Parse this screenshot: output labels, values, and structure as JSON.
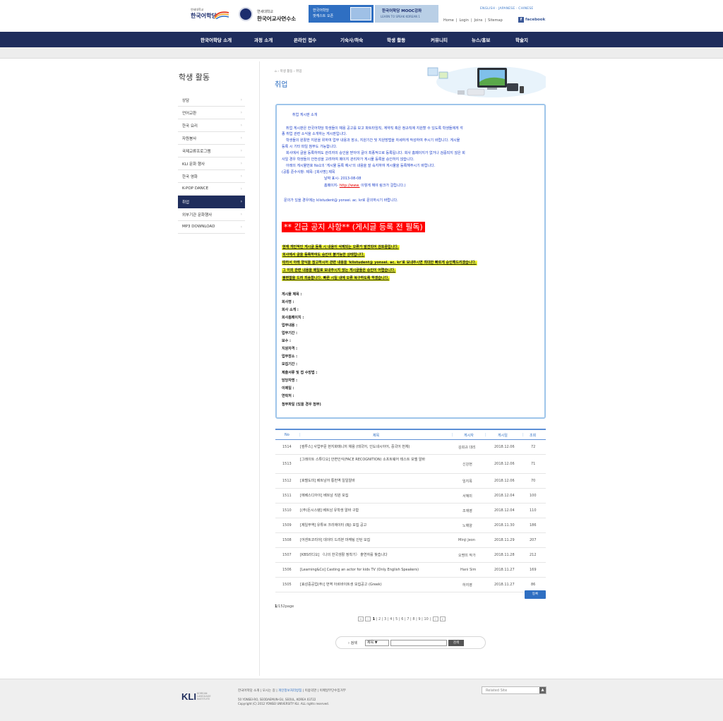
{
  "header": {
    "logo1_small": "연세대학교",
    "logo1_large": "한국어학당",
    "logo2_small": "연세대학교",
    "logo2_large": "한국어교사연수소",
    "banner1_line1": "한국어학당",
    "banner1_line2": "팟캐스트 오픈",
    "banner2_line1": "한국어학당 MOOC강좌",
    "banner2_line2": "LEARN TO SPEAK KOREAN 1",
    "languages": "ENGLISH · JAPANESE · CHINESE",
    "utils": [
      "Home",
      "|",
      "Login",
      "|",
      "Joins",
      "|",
      "Sitemap"
    ],
    "facebook": "facebook"
  },
  "nav": {
    "items": [
      "한국어학당 소개",
      "과정 소개",
      "온라인 접수",
      "기숙사/하숙",
      "학생 활동",
      "커뮤니티",
      "뉴스/홍보",
      "학술지"
    ]
  },
  "sidebar": {
    "title": "학생 활동",
    "items": [
      {
        "label": "상담"
      },
      {
        "label": "언어교환"
      },
      {
        "label": "한국 요리"
      },
      {
        "label": "자원봉사"
      },
      {
        "label": "국제교류프로그램"
      },
      {
        "label": "KLI 문화 행사"
      },
      {
        "label": "한국 영화"
      },
      {
        "label": "K-POP DANCE"
      },
      {
        "label": "취업"
      },
      {
        "label": "외부기관 문화행사"
      },
      {
        "label": "MP3 DOWNLOAD"
      }
    ],
    "arrow": "›"
  },
  "content": {
    "breadcrumb": "⌂  › 학생 활동  › 취업",
    "title": "취업",
    "notice": {
      "l1": "취업 게시판 소개",
      "l2": "취업 게시판은 한국어학당 학생들이 채용 공고를 보고 파트타임직, 계약직 혹은 정규직에 지원할 수 있도록  학생들에게 각",
      "l3": "종 취업 관련 소식을 소개하는 게시판입니다.",
      "l4": "학생들의 원활한  지원을 위하여  업무 내용과  장소, 지원기간 및  지원방법을 자세하게 작성하여 주시기 바랍니다. 게시물",
      "l5": "등록 시 기타 파일  첨부도 가능합니다.",
      "l6": "회사에서 글을 등록하여도 관리자의 승인을 받아야 글이 최종적으로 등록됩니다. 회사 홈페이지가 없거나 검증되지 않은 회",
      "l7": "사일 경우 학생들의 안전성을 고려하여 페이지 관리자가 게시물 등록을 승인하지 않습니다.",
      "l8": "아래의 게시물번호 No1의 '게시물 등록 예시'의 내용을 잘 숙지하여 게시물을 등록해주시기 바랍니다.",
      "l9": "(공통 준수사항: 제목- [회사명] 제목",
      "l10": "날짜 표시- 2013-08-08",
      "l11a": "홈페이지- ",
      "l11b": "http://www.",
      "l11c": " 이렇게 해야 링크가 걸립니다.)",
      "l12": "문의가 있을 경우에는 klistudent@ yonsei. ac. kr로 문의하시기 바랍니다.",
      "urgent": "** 긴급 공지 사항** (게시글 등록 전 필독)",
      "h1": "현재 개인적인 게시글 등록 시 내용이 삭제되는 오류가 발견되어 검토중입니다.",
      "h2": "회사에서 글을 등록하여도 승인이 불가능한 상태입니다.",
      "h3": "따라서 아래 양식을 참고하시어 관련 내용을 'klistudent@ yonsei. ac. kr'로 보내주시면 최대한 빠르게 승인해드리겠습니다.",
      "h4": "그 이외 관련 내용을 메일로 보내주시지 않는 게시글들은 승인이 어렵습니다.",
      "h5": "불편함을 드려 죄송합니다. 빠른 시일 내에 오류 복구하도록 하겠습니다.",
      "fields": [
        "게시물 제목 :",
        "회사명 :",
        "회사 소개 :",
        "회사홈페이지 :",
        "업무내용 :",
        "업무기간 :",
        "보수 :",
        "지원자격 :",
        "업무장소 :",
        "모집기간 :",
        "제출서류 및 접 수방법 :",
        "담당자명 :",
        "이메일 :",
        "연락처 :",
        "첨부파일 (있을 경우 첨부)"
      ]
    },
    "table": {
      "headers": {
        "no": "No",
        "title": "제목",
        "writer": "게시자",
        "date": "게시일",
        "views": "조회"
      },
      "rows": [
        {
          "no": "1514",
          "title": "[컴투스] 사업부문 현지화매니저 채용 (태국어, 인도네시아어, 중국어 번체)",
          "writer": "김희규 대리",
          "date": "2018.12.06",
          "views": "72"
        },
        {
          "no": "1513",
          "title": "[그레이트 스튜디오] 안면인식(FACE RECOGNITION) 소프트웨어 테스트 모델 알바",
          "writer": "신강현",
          "date": "2018.12.06",
          "views": "71"
        },
        {
          "no": "1512",
          "title": "[호텔도미] 베트남어 통번역 일일알바",
          "writer": "임지목",
          "date": "2018.12.06",
          "views": "70"
        },
        {
          "no": "1511",
          "title": "[에베스디아이] 베트남 직원 모집",
          "writer": "서혜미",
          "date": "2018.12.04",
          "views": "100"
        },
        {
          "no": "1510",
          "title": "[(주)돈시스템] 베트남 유학생 알바 구함",
          "writer": "조재영",
          "date": "2018.12.04",
          "views": "110"
        },
        {
          "no": "1509",
          "title": "[제일무역] 유튜브 크리에이터 (BJ) 모집 공고",
          "writer": "노해양",
          "date": "2018.11.30",
          "views": "186"
        },
        {
          "no": "1508",
          "title": "[어센트코리아] 데이터 드리븐 마케팅 인턴 모집",
          "writer": "Minji Jeon",
          "date": "2018.11.29",
          "views": "207"
        },
        {
          "no": "1507",
          "title": "[KBS라디오] 〈나의 한국생활 정착기〉 출연자를 찾습니다",
          "writer": "오명미 작가",
          "date": "2018.11.28",
          "views": "212"
        },
        {
          "no": "1506",
          "title": "[Learning&Co] Casting an actor for kids TV (Only English Speakers)",
          "writer": "Hani Sim",
          "date": "2018.11.27",
          "views": "169"
        },
        {
          "no": "1505",
          "title": "[효성중공업(주)] 번역 아르바이트생 모집공고 (Greek)",
          "writer": "하지영",
          "date": "2018.11.27",
          "views": "86"
        }
      ]
    },
    "register_button": "등록",
    "page_current": "1",
    "page_total": "/152page",
    "pager": {
      "first": "«",
      "prev": "‹",
      "pages": [
        "1",
        "2",
        "3",
        "4",
        "5",
        "6",
        "7",
        "8",
        "9",
        "10"
      ],
      "next": "›",
      "last": "»"
    },
    "search": {
      "label": "› 검색",
      "select_value": "제목 ▼",
      "button": "검색"
    }
  },
  "footer": {
    "logo": "KLI",
    "logo_small1": "KOREAN",
    "logo_small2": "LANGUAGE",
    "logo_small3": "INSTITUTE",
    "links_a": "한국어학당 소개  |  모시는 길  |  ",
    "links_b": "개인정보처리방침",
    "links_c": "  |  이용약관  |  이메일무단수집거부",
    "address1": "50 YONSEI-RO, SEODAEMUN-GU, SEOUL, KOREA  03722",
    "address2": "Copyright (C) 2012 YONSEI UNIVERSITY KLI.  ALL rights reserved.",
    "related_site": "Related Site",
    "related_btn": "▲"
  }
}
